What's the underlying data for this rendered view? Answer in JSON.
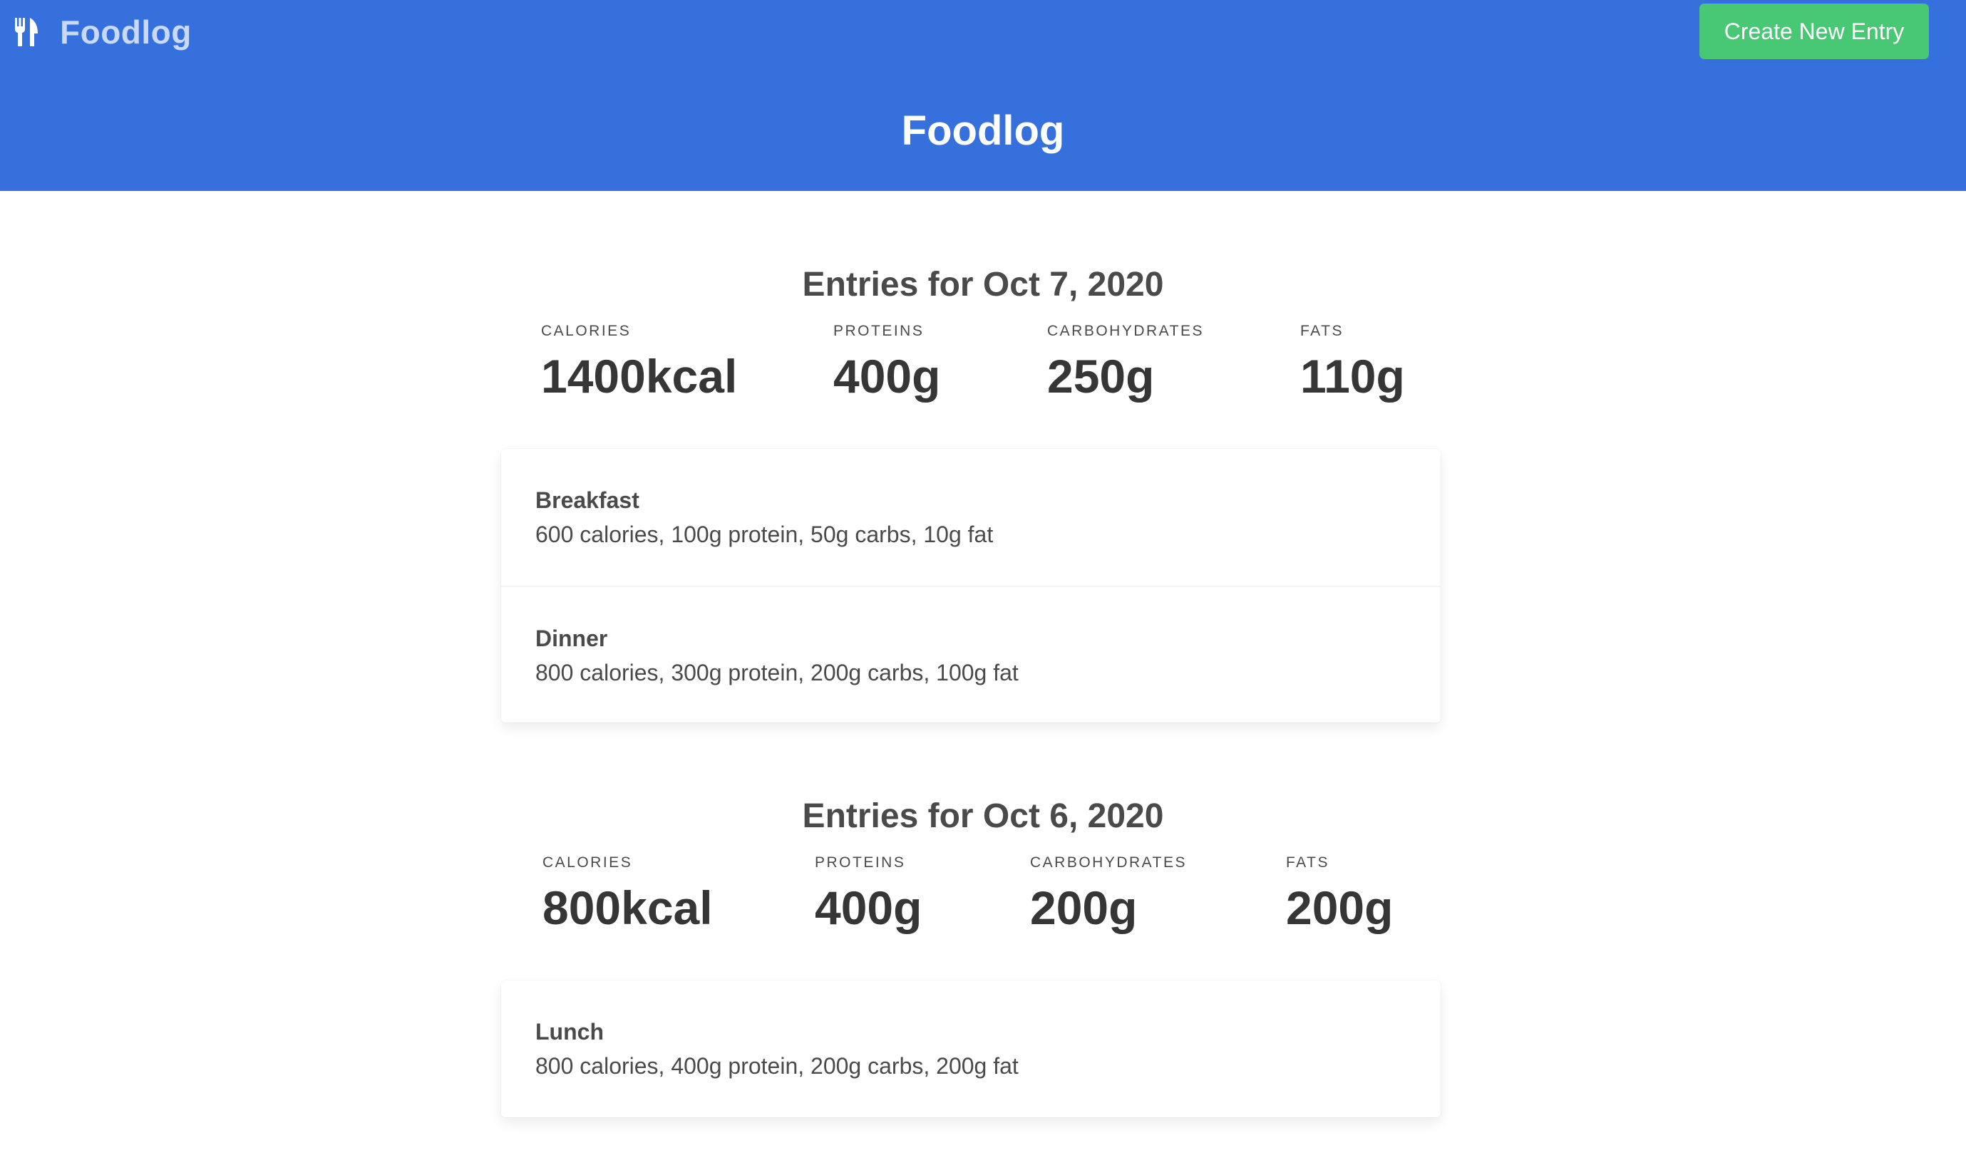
{
  "navbar": {
    "brand_icon": "fork-knife-icon",
    "brand_label": "Foodlog",
    "create_button_label": "Create New Entry"
  },
  "hero": {
    "title": "Foodlog"
  },
  "colors": {
    "hero_bg": "#3570dd",
    "button_bg": "#48c774",
    "brand_text": "#c9d9f7"
  },
  "days": [
    {
      "title": "Entries for Oct 7, 2020",
      "stats": [
        {
          "label": "CALORIES",
          "value": "1400kcal"
        },
        {
          "label": "PROTEINS",
          "value": "400g"
        },
        {
          "label": "CARBOHYDRATES",
          "value": "250g"
        },
        {
          "label": "FATS",
          "value": "110g"
        }
      ],
      "entries": [
        {
          "name": "Breakfast",
          "detail": "600 calories, 100g protein, 50g carbs, 10g fat"
        },
        {
          "name": "Dinner",
          "detail": "800 calories, 300g protein, 200g carbs, 100g fat"
        }
      ]
    },
    {
      "title": "Entries for Oct 6, 2020",
      "stats": [
        {
          "label": "CALORIES",
          "value": "800kcal"
        },
        {
          "label": "PROTEINS",
          "value": "400g"
        },
        {
          "label": "CARBOHYDRATES",
          "value": "200g"
        },
        {
          "label": "FATS",
          "value": "200g"
        }
      ],
      "entries": [
        {
          "name": "Lunch",
          "detail": "800 calories, 400g protein, 200g carbs, 200g fat"
        }
      ]
    }
  ]
}
